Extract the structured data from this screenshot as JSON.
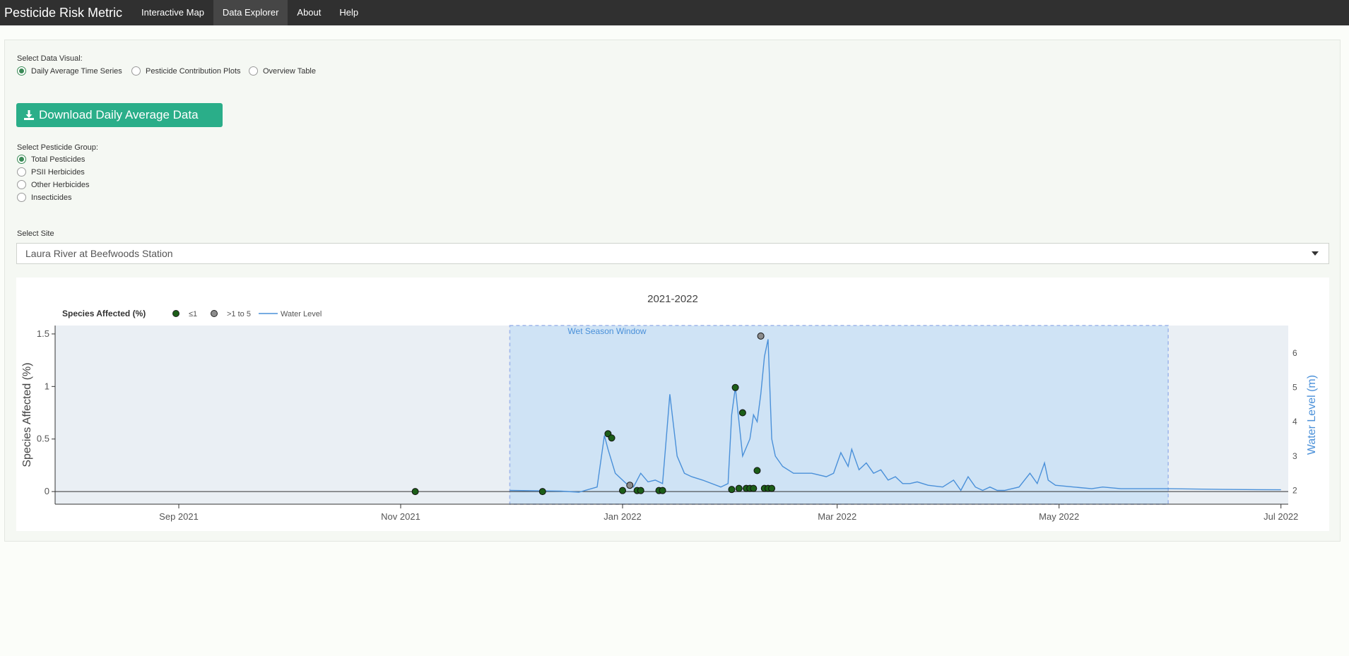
{
  "nav": {
    "brand": "Pesticide Risk Metric",
    "items": [
      "Interactive Map",
      "Data Explorer",
      "About",
      "Help"
    ],
    "active_index": 1
  },
  "visual": {
    "label": "Select Data Visual:",
    "options": [
      "Daily Average Time Series",
      "Pesticide Contribution Plots",
      "Overview Table"
    ],
    "selected": 0
  },
  "download": {
    "label": "Download Daily Average Data"
  },
  "group": {
    "label": "Select Pesticide Group:",
    "options": [
      "Total Pesticides",
      "PSII Herbicides",
      "Other Herbicides",
      "Insecticides"
    ],
    "selected": 0
  },
  "site": {
    "label": "Select Site",
    "value": "Laura River at Beefwoods Station"
  },
  "colors": {
    "accent": "#3a8a56",
    "button": "#2aae89",
    "low": "#1c5e18",
    "mid": "#8c8c8c",
    "water": "#4a90d9",
    "window": "#cfe3f5"
  },
  "chart_data": {
    "type": "scatter",
    "title": "2021-2022",
    "legend": {
      "title": "Species Affected (%)",
      "entries": [
        "≤1",
        ">1 to 5",
        "Water Level"
      ],
      "placement": "top-left"
    },
    "ylabel": "Species Affected (%)",
    "y2label": "Water Level (m)",
    "ylim": [
      -0.12,
      1.58
    ],
    "y2lim": [
      1.6,
      6.8
    ],
    "xlim": [
      "2021-07-29",
      "2022-07-03"
    ],
    "yticks": [
      "0",
      "0.5",
      "1",
      "1.5"
    ],
    "y2ticks": [
      "2",
      "3",
      "4",
      "5",
      "6"
    ],
    "xticks": [
      "Sep 2021",
      "Nov 2021",
      "Jan 2022",
      "Mar 2022",
      "May 2022",
      "Jul 2022"
    ],
    "annotation": "Wet Season Window",
    "window": [
      "2021-12-01",
      "2022-05-31"
    ],
    "series": [
      {
        "name": "≤1",
        "kind": "points",
        "x": [
          "2021-11-05",
          "2021-12-10",
          "2021-12-28",
          "2021-12-29",
          "2022-01-01",
          "2022-01-05",
          "2022-01-06",
          "2022-01-11",
          "2022-01-12",
          "2022-01-31",
          "2022-02-01",
          "2022-02-02",
          "2022-02-03",
          "2022-02-04",
          "2022-02-05",
          "2022-02-06",
          "2022-02-07",
          "2022-02-09",
          "2022-02-10",
          "2022-02-11"
        ],
        "y": [
          0,
          0,
          0.55,
          0.51,
          0.01,
          0.01,
          0.01,
          0.01,
          0.01,
          0.02,
          0.99,
          0.03,
          0.75,
          0.03,
          0.03,
          0.03,
          0.2,
          0.03,
          0.03,
          0.03
        ]
      },
      {
        "name": ">1 to 5",
        "kind": "points",
        "x": [
          "2022-01-03",
          "2022-02-08"
        ],
        "y": [
          0.06,
          1.48
        ]
      },
      {
        "name": "Water Level",
        "kind": "line",
        "axis": "y2",
        "x": [
          "2021-12-01",
          "2021-12-15",
          "2021-12-20",
          "2021-12-25",
          "2021-12-27",
          "2021-12-28",
          "2021-12-30",
          "2022-01-02",
          "2022-01-04",
          "2022-01-06",
          "2022-01-08",
          "2022-01-10",
          "2022-01-12",
          "2022-01-13",
          "2022-01-14",
          "2022-01-16",
          "2022-01-18",
          "2022-01-20",
          "2022-01-23",
          "2022-01-28",
          "2022-01-30",
          "2022-01-31",
          "2022-02-01",
          "2022-02-03",
          "2022-02-05",
          "2022-02-06",
          "2022-02-07",
          "2022-02-08",
          "2022-02-09",
          "2022-02-10",
          "2022-02-11",
          "2022-02-12",
          "2022-02-14",
          "2022-02-17",
          "2022-02-22",
          "2022-02-26",
          "2022-02-28",
          "2022-03-02",
          "2022-03-04",
          "2022-03-05",
          "2022-03-07",
          "2022-03-09",
          "2022-03-11",
          "2022-03-13",
          "2022-03-15",
          "2022-03-17",
          "2022-03-19",
          "2022-03-21",
          "2022-03-23",
          "2022-03-26",
          "2022-03-30",
          "2022-04-02",
          "2022-04-04",
          "2022-04-06",
          "2022-04-08",
          "2022-04-10",
          "2022-04-12",
          "2022-04-14",
          "2022-04-16",
          "2022-04-20",
          "2022-04-23",
          "2022-04-25",
          "2022-04-27",
          "2022-04-28",
          "2022-04-30",
          "2022-05-05",
          "2022-05-10",
          "2022-05-13",
          "2022-05-18",
          "2022-05-31",
          "2022-06-15",
          "2022-07-01"
        ],
        "y": [
          2.0,
          1.98,
          1.95,
          2.1,
          3.6,
          3.2,
          2.5,
          2.2,
          2.1,
          2.5,
          2.25,
          2.3,
          2.2,
          3.5,
          4.8,
          3.0,
          2.5,
          2.4,
          2.3,
          2.1,
          2.2,
          4.2,
          5.0,
          3.0,
          3.5,
          4.2,
          4.0,
          4.8,
          5.9,
          6.4,
          3.5,
          3.0,
          2.7,
          2.5,
          2.5,
          2.4,
          2.5,
          3.1,
          2.7,
          3.2,
          2.6,
          2.8,
          2.5,
          2.6,
          2.3,
          2.4,
          2.2,
          2.2,
          2.25,
          2.15,
          2.1,
          2.3,
          2.0,
          2.4,
          2.1,
          2.0,
          2.1,
          2.0,
          2.0,
          2.1,
          2.5,
          2.2,
          2.8,
          2.3,
          2.15,
          2.1,
          2.05,
          2.1,
          2.05,
          2.05,
          2.03,
          2.02
        ]
      }
    ]
  }
}
